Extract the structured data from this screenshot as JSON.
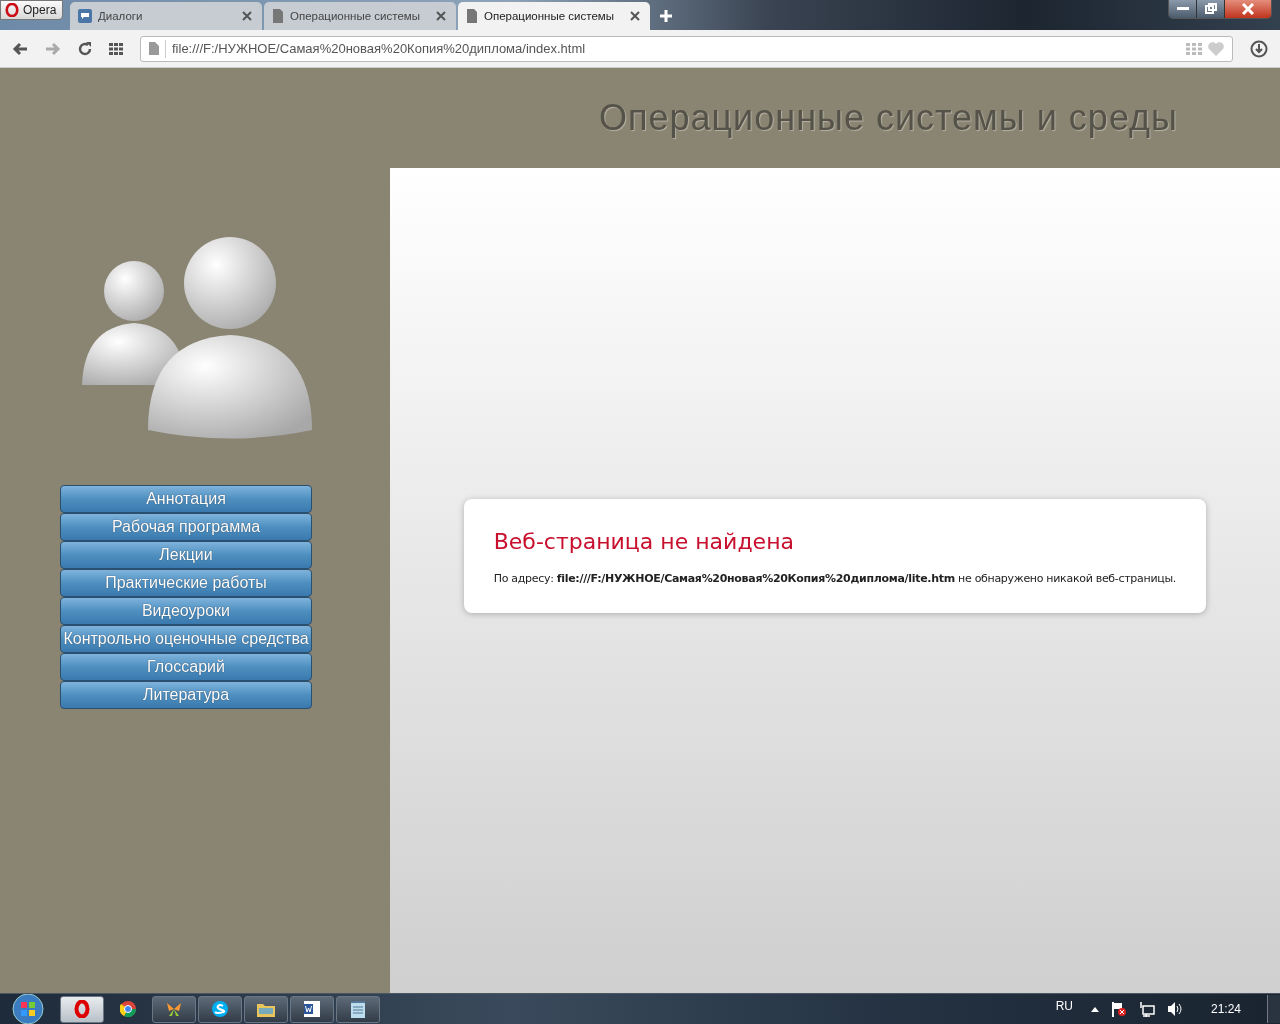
{
  "browser": {
    "menu_label": "Opera",
    "tabs": [
      {
        "title": "Диалоги",
        "selected": false,
        "kind": "chat"
      },
      {
        "title": "Операционные системы",
        "selected": false,
        "kind": "page"
      },
      {
        "title": "Операционные системы",
        "selected": true,
        "kind": "page"
      }
    ],
    "address": "file:///F:/НУЖНОЕ/Самая%20новая%20Копия%20диплома/index.html"
  },
  "page": {
    "title": "Операционные системы и среды",
    "nav": [
      "Аннотация",
      "Рабочая программа",
      "Лекции",
      "Практические работы",
      "Видеоуроки",
      "Контрольно оценочные средства",
      "Глоссарий",
      "Литература"
    ],
    "error": {
      "heading": "Веб-страница не найдена",
      "message": "По адресу: **file:///F:/НУЖНОЕ/Самая%20новая%20Копия%20диплома/lite.htm** не обнаружено никакой веб-страницы."
    }
  },
  "taskbar": {
    "language": "RU",
    "time": "21:24"
  }
}
